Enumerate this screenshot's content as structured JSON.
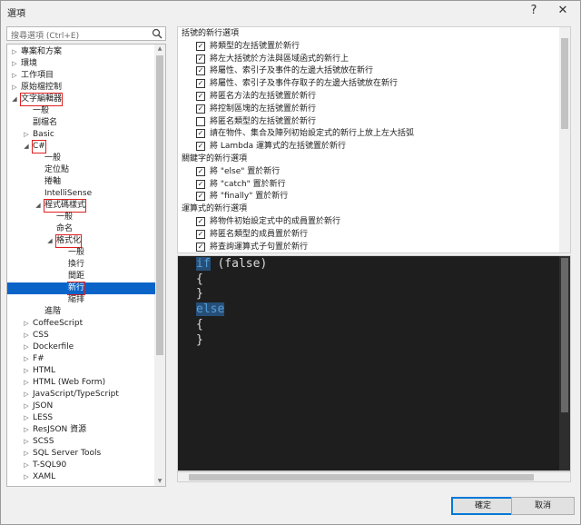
{
  "window": {
    "title": "選項",
    "help_icon": "?",
    "close_icon": "✕"
  },
  "search": {
    "placeholder": "搜尋選項 (Ctrl+E)"
  },
  "tree": {
    "items": [
      {
        "label": "專案和方案",
        "level": 0,
        "arrow": "▷"
      },
      {
        "label": "環境",
        "level": 0,
        "arrow": "▷"
      },
      {
        "label": "工作項目",
        "level": 0,
        "arrow": "▷"
      },
      {
        "label": "原始檔控制",
        "level": 0,
        "arrow": "▷"
      },
      {
        "label": "文字編輯器",
        "level": 0,
        "arrow": "◢",
        "highlight": true
      },
      {
        "label": "一般",
        "level": 1,
        "arrow": ""
      },
      {
        "label": "副檔名",
        "level": 1,
        "arrow": ""
      },
      {
        "label": "Basic",
        "level": 1,
        "arrow": "▷"
      },
      {
        "label": "C#",
        "level": 1,
        "arrow": "◢",
        "highlight": true
      },
      {
        "label": "一般",
        "level": 2,
        "arrow": ""
      },
      {
        "label": "定位點",
        "level": 2,
        "arrow": ""
      },
      {
        "label": "捲軸",
        "level": 2,
        "arrow": ""
      },
      {
        "label": "IntelliSense",
        "level": 2,
        "arrow": ""
      },
      {
        "label": "程式碼樣式",
        "level": 2,
        "arrow": "◢",
        "highlight": true
      },
      {
        "label": "一般",
        "level": 3,
        "arrow": ""
      },
      {
        "label": "命名",
        "level": 3,
        "arrow": ""
      },
      {
        "label": "格式化",
        "level": 3,
        "arrow": "◢",
        "highlight": true
      },
      {
        "label": "一般",
        "level": 4,
        "arrow": ""
      },
      {
        "label": "換行",
        "level": 4,
        "arrow": ""
      },
      {
        "label": "間距",
        "level": 4,
        "arrow": ""
      },
      {
        "label": "新行",
        "level": 4,
        "arrow": "",
        "selected": true,
        "highlight": true
      },
      {
        "label": "縮排",
        "level": 4,
        "arrow": ""
      },
      {
        "label": "進階",
        "level": 2,
        "arrow": ""
      },
      {
        "label": "CoffeeScript",
        "level": 1,
        "arrow": "▷"
      },
      {
        "label": "CSS",
        "level": 1,
        "arrow": "▷"
      },
      {
        "label": "Dockerfile",
        "level": 1,
        "arrow": "▷"
      },
      {
        "label": "F#",
        "level": 1,
        "arrow": "▷"
      },
      {
        "label": "HTML",
        "level": 1,
        "arrow": "▷"
      },
      {
        "label": "HTML (Web Form)",
        "level": 1,
        "arrow": "▷"
      },
      {
        "label": "JavaScript/TypeScript",
        "level": 1,
        "arrow": "▷"
      },
      {
        "label": "JSON",
        "level": 1,
        "arrow": "▷"
      },
      {
        "label": "LESS",
        "level": 1,
        "arrow": "▷"
      },
      {
        "label": "ResJSON 資源",
        "level": 1,
        "arrow": "▷"
      },
      {
        "label": "SCSS",
        "level": 1,
        "arrow": "▷"
      },
      {
        "label": "SQL Server Tools",
        "level": 1,
        "arrow": "▷"
      },
      {
        "label": "T-SQL90",
        "level": 1,
        "arrow": "▷"
      },
      {
        "label": "XAML",
        "level": 1,
        "arrow": "▷"
      }
    ]
  },
  "options": {
    "rows": [
      {
        "type": "header",
        "label": "括號的新行選項"
      },
      {
        "type": "check",
        "checked": true,
        "label": "將類型的左括號置於新行"
      },
      {
        "type": "check",
        "checked": true,
        "label": "將左大括號於方法與區域函式的新行上"
      },
      {
        "type": "check",
        "checked": true,
        "label": "將屬性、索引子及事件的左邊大括號放在新行"
      },
      {
        "type": "check",
        "checked": true,
        "label": "將屬性、索引子及事件存取子的左邊大括號放在新行"
      },
      {
        "type": "check",
        "checked": true,
        "label": "將匿名方法的左括號置於新行"
      },
      {
        "type": "check",
        "checked": true,
        "label": "將控制區塊的左括號置於新行"
      },
      {
        "type": "check",
        "checked": false,
        "label": "將匿名類型的左括號置於新行"
      },
      {
        "type": "check",
        "checked": true,
        "label": "請在物件、集合及陣列初始設定式的新行上放上左大括弧"
      },
      {
        "type": "check",
        "checked": true,
        "label": "將 Lambda 運算式的左括號置於新行"
      },
      {
        "type": "header",
        "label": "關鍵字的新行選項"
      },
      {
        "type": "check",
        "checked": true,
        "label": "將 \"else\" 置於新行"
      },
      {
        "type": "check",
        "checked": true,
        "label": "將 \"catch\" 置於新行"
      },
      {
        "type": "check",
        "checked": true,
        "label": "將 \"finally\" 置於新行"
      },
      {
        "type": "header",
        "label": "運算式的新行選項"
      },
      {
        "type": "check",
        "checked": true,
        "label": "將物件初始設定式中的成員置於新行"
      },
      {
        "type": "check",
        "checked": true,
        "label": "將匿名類型的成員置於新行"
      },
      {
        "type": "check",
        "checked": true,
        "label": "將查詢運算式子句置於新行"
      }
    ]
  },
  "preview": {
    "line1_kw": "if",
    "line1_rest": " (false)",
    "line2": "{",
    "line3": "}",
    "line4_kw": "else",
    "line5": "{",
    "line6": "}"
  },
  "buttons": {
    "ok": "確定",
    "cancel": "取消"
  }
}
